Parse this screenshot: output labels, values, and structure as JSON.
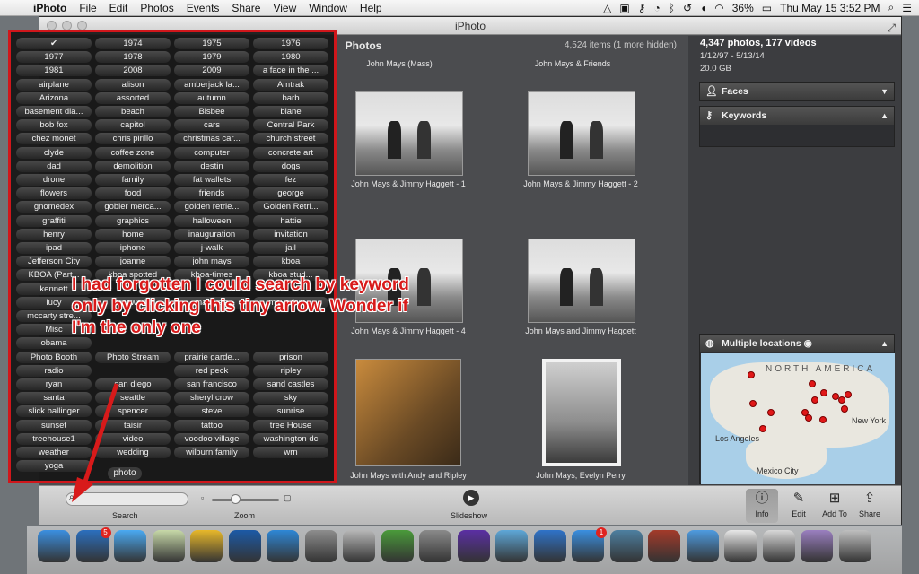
{
  "menubar": {
    "apple_glyph": "",
    "items": [
      "iPhoto",
      "File",
      "Edit",
      "Photos",
      "Events",
      "Share",
      "View",
      "Window",
      "Help"
    ],
    "battery": "36%",
    "datetime": "Thu May 15  3:52 PM"
  },
  "window": {
    "title": "iPhoto"
  },
  "main": {
    "title": "Photos",
    "count": "4,524 items (1 more hidden)",
    "top_captions": [
      "John Mays (Mass)",
      "John Mays & Friends"
    ],
    "photos": [
      {
        "caption": "John Mays & Jimmy Haggett - 1",
        "style": "bw"
      },
      {
        "caption": "John Mays & Jimmy Haggett - 2",
        "style": "bw"
      },
      {
        "caption": "John Mays & Jimmy Haggett - 4",
        "style": "bw"
      },
      {
        "caption": "John Mays and Jimmy Haggett",
        "style": "bw"
      },
      {
        "caption": "John Mays with Andy and Ripley",
        "style": "color"
      },
      {
        "caption": "John Mays, Evelyn Perry",
        "style": "portrait"
      }
    ]
  },
  "keywords": {
    "check_glyph": "✔",
    "rows": [
      [
        "✔",
        "1974",
        "1975",
        "1976"
      ],
      [
        "1977",
        "1978",
        "1979",
        "1980"
      ],
      [
        "1981",
        "2008",
        "2009",
        "a face in the ..."
      ],
      [
        "airplane",
        "alison",
        "amberjack la...",
        "Amtrak"
      ],
      [
        "Arizona",
        "assorted",
        "autumn",
        "barb"
      ],
      [
        "basement dia...",
        "beach",
        "Bisbee",
        "blane"
      ],
      [
        "bob fox",
        "capitol",
        "cars",
        "Central Park"
      ],
      [
        "chez monet",
        "chris pirillo",
        "christmas car...",
        "church street"
      ],
      [
        "clyde",
        "coffee zone",
        "computer",
        "concrete art"
      ],
      [
        "dad",
        "demolition",
        "destin",
        "dogs"
      ],
      [
        "drone",
        "family",
        "fat wallets",
        "fez"
      ],
      [
        "flowers",
        "food",
        "friends",
        "george"
      ],
      [
        "gnomedex",
        "gobler merca...",
        "golden retrie...",
        "Golden Retri..."
      ],
      [
        "graffiti",
        "graphics",
        "halloween",
        "hattie"
      ],
      [
        "henry",
        "home",
        "inauguration",
        "invitation"
      ],
      [
        "ipad",
        "iphone",
        "j-walk",
        "jail"
      ],
      [
        "Jefferson City",
        "joanne",
        "john mays",
        "kboa"
      ],
      [
        "KBOA (Part...",
        "kboa spotted",
        "kboa-times",
        "kboa stud..."
      ],
      [
        "kennett",
        "",
        "",
        ""
      ],
      [
        "lucy",
        "macworld",
        "malaysia",
        "mays fam..."
      ],
      [
        "mccarty stre...",
        "",
        "",
        ""
      ],
      [
        "Misc",
        "",
        "",
        ""
      ],
      [
        "obama",
        "",
        "",
        ""
      ],
      [
        "Photo Booth",
        "Photo Stream",
        "prairie garde...",
        "prison"
      ],
      [
        "radio",
        "",
        "red peck",
        "ripley"
      ],
      [
        "ryan",
        "san diego",
        "san francisco",
        "sand castles"
      ],
      [
        "santa",
        "seattle",
        "sheryl crow",
        "sky"
      ],
      [
        "slick ballinger",
        "spencer",
        "steve",
        "sunrise"
      ],
      [
        "sunset",
        "taisir",
        "tattoo",
        "tree House"
      ],
      [
        "treehouse1",
        "video",
        "voodoo village",
        "washington dc"
      ],
      [
        "weather",
        "wedding",
        "wilburn family",
        "wrn"
      ],
      [
        "yoga",
        "",
        "",
        ""
      ]
    ],
    "selected": "photo"
  },
  "annotation": {
    "text": "I had forgotten I could search by keyword only by clicking this tiny arrow. Wonder if I'm the only one",
    "color": "#d81a1a"
  },
  "info": {
    "summary": "4,347 photos, 177 videos",
    "date_range": "1/12/97 - 5/13/14",
    "size": "20.0 GB",
    "faces_label": "Faces",
    "keywords_label": "Keywords",
    "locations_label": "Multiple locations",
    "map": {
      "north_america": "NORTH AMERICA",
      "new_york": "New York",
      "los_angeles": "Los Angeles",
      "mexico_city": "Mexico City",
      "pin_count": 14
    }
  },
  "toolbar": {
    "search_label": "Search",
    "search_icon": "magnifier-icon",
    "zoom_label": "Zoom",
    "zoom_level": 0.35,
    "slideshow_label": "Slideshow",
    "info_label": "Info",
    "edit_label": "Edit",
    "addto_label": "Add To",
    "share_label": "Share"
  },
  "dock": {
    "apps": [
      {
        "name": "Finder",
        "color": "#3b8fe0"
      },
      {
        "name": "Tweetbot",
        "color": "#2b6fbe",
        "badge": "5"
      },
      {
        "name": "Messages",
        "color": "#4aa9f2"
      },
      {
        "name": "Preview",
        "color": "#c7d9a8"
      },
      {
        "name": "Chrome",
        "color": "#e8b82a"
      },
      {
        "name": "1Password",
        "color": "#1c5aa6"
      },
      {
        "name": "Safari",
        "color": "#2e87d6"
      },
      {
        "name": "System Preferences",
        "color": "#8d8d8d"
      },
      {
        "name": "Preview Photos",
        "color": "#b7b7b7"
      },
      {
        "name": "Google Drive",
        "color": "#4a9a3a"
      },
      {
        "name": "Launchpad",
        "color": "#8a8a8a"
      },
      {
        "name": "iMovie",
        "color": "#5b2fa3"
      },
      {
        "name": "iPhoto",
        "color": "#5ea7d8"
      },
      {
        "name": "iTunes",
        "color": "#2f73c8"
      },
      {
        "name": "App Store",
        "color": "#3a8fe0",
        "badge": "1"
      },
      {
        "name": "Time Machine",
        "color": "#4d7fa0"
      },
      {
        "name": "Photo Booth",
        "color": "#a33a2a"
      },
      {
        "name": "Mail",
        "color": "#4e9be0"
      },
      {
        "name": "TextEdit",
        "color": "#e8e8e8"
      },
      {
        "name": "Documents",
        "color": "#d8d8d8"
      },
      {
        "name": "Downloads",
        "color": "#9a7fc0"
      },
      {
        "name": "Trash",
        "color": "#bfbfbf"
      }
    ]
  }
}
